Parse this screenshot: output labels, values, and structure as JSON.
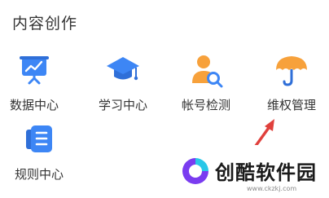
{
  "section": {
    "title": "内容创作"
  },
  "items": [
    {
      "label": "数据中心",
      "icon": "presentation-chart-icon"
    },
    {
      "label": "学习中心",
      "icon": "graduation-cap-icon"
    },
    {
      "label": "帐号检测",
      "icon": "user-search-icon"
    },
    {
      "label": "维权管理",
      "icon": "umbrella-icon"
    },
    {
      "label": "规则中心",
      "icon": "rulebook-icon"
    }
  ],
  "watermark": {
    "name": "创酷软件园",
    "url": "www.ckzkj.com"
  },
  "colors": {
    "icon_blue": "#3d86f5",
    "icon_orange": "#f7a13b",
    "arrow_red": "#e0403c"
  }
}
